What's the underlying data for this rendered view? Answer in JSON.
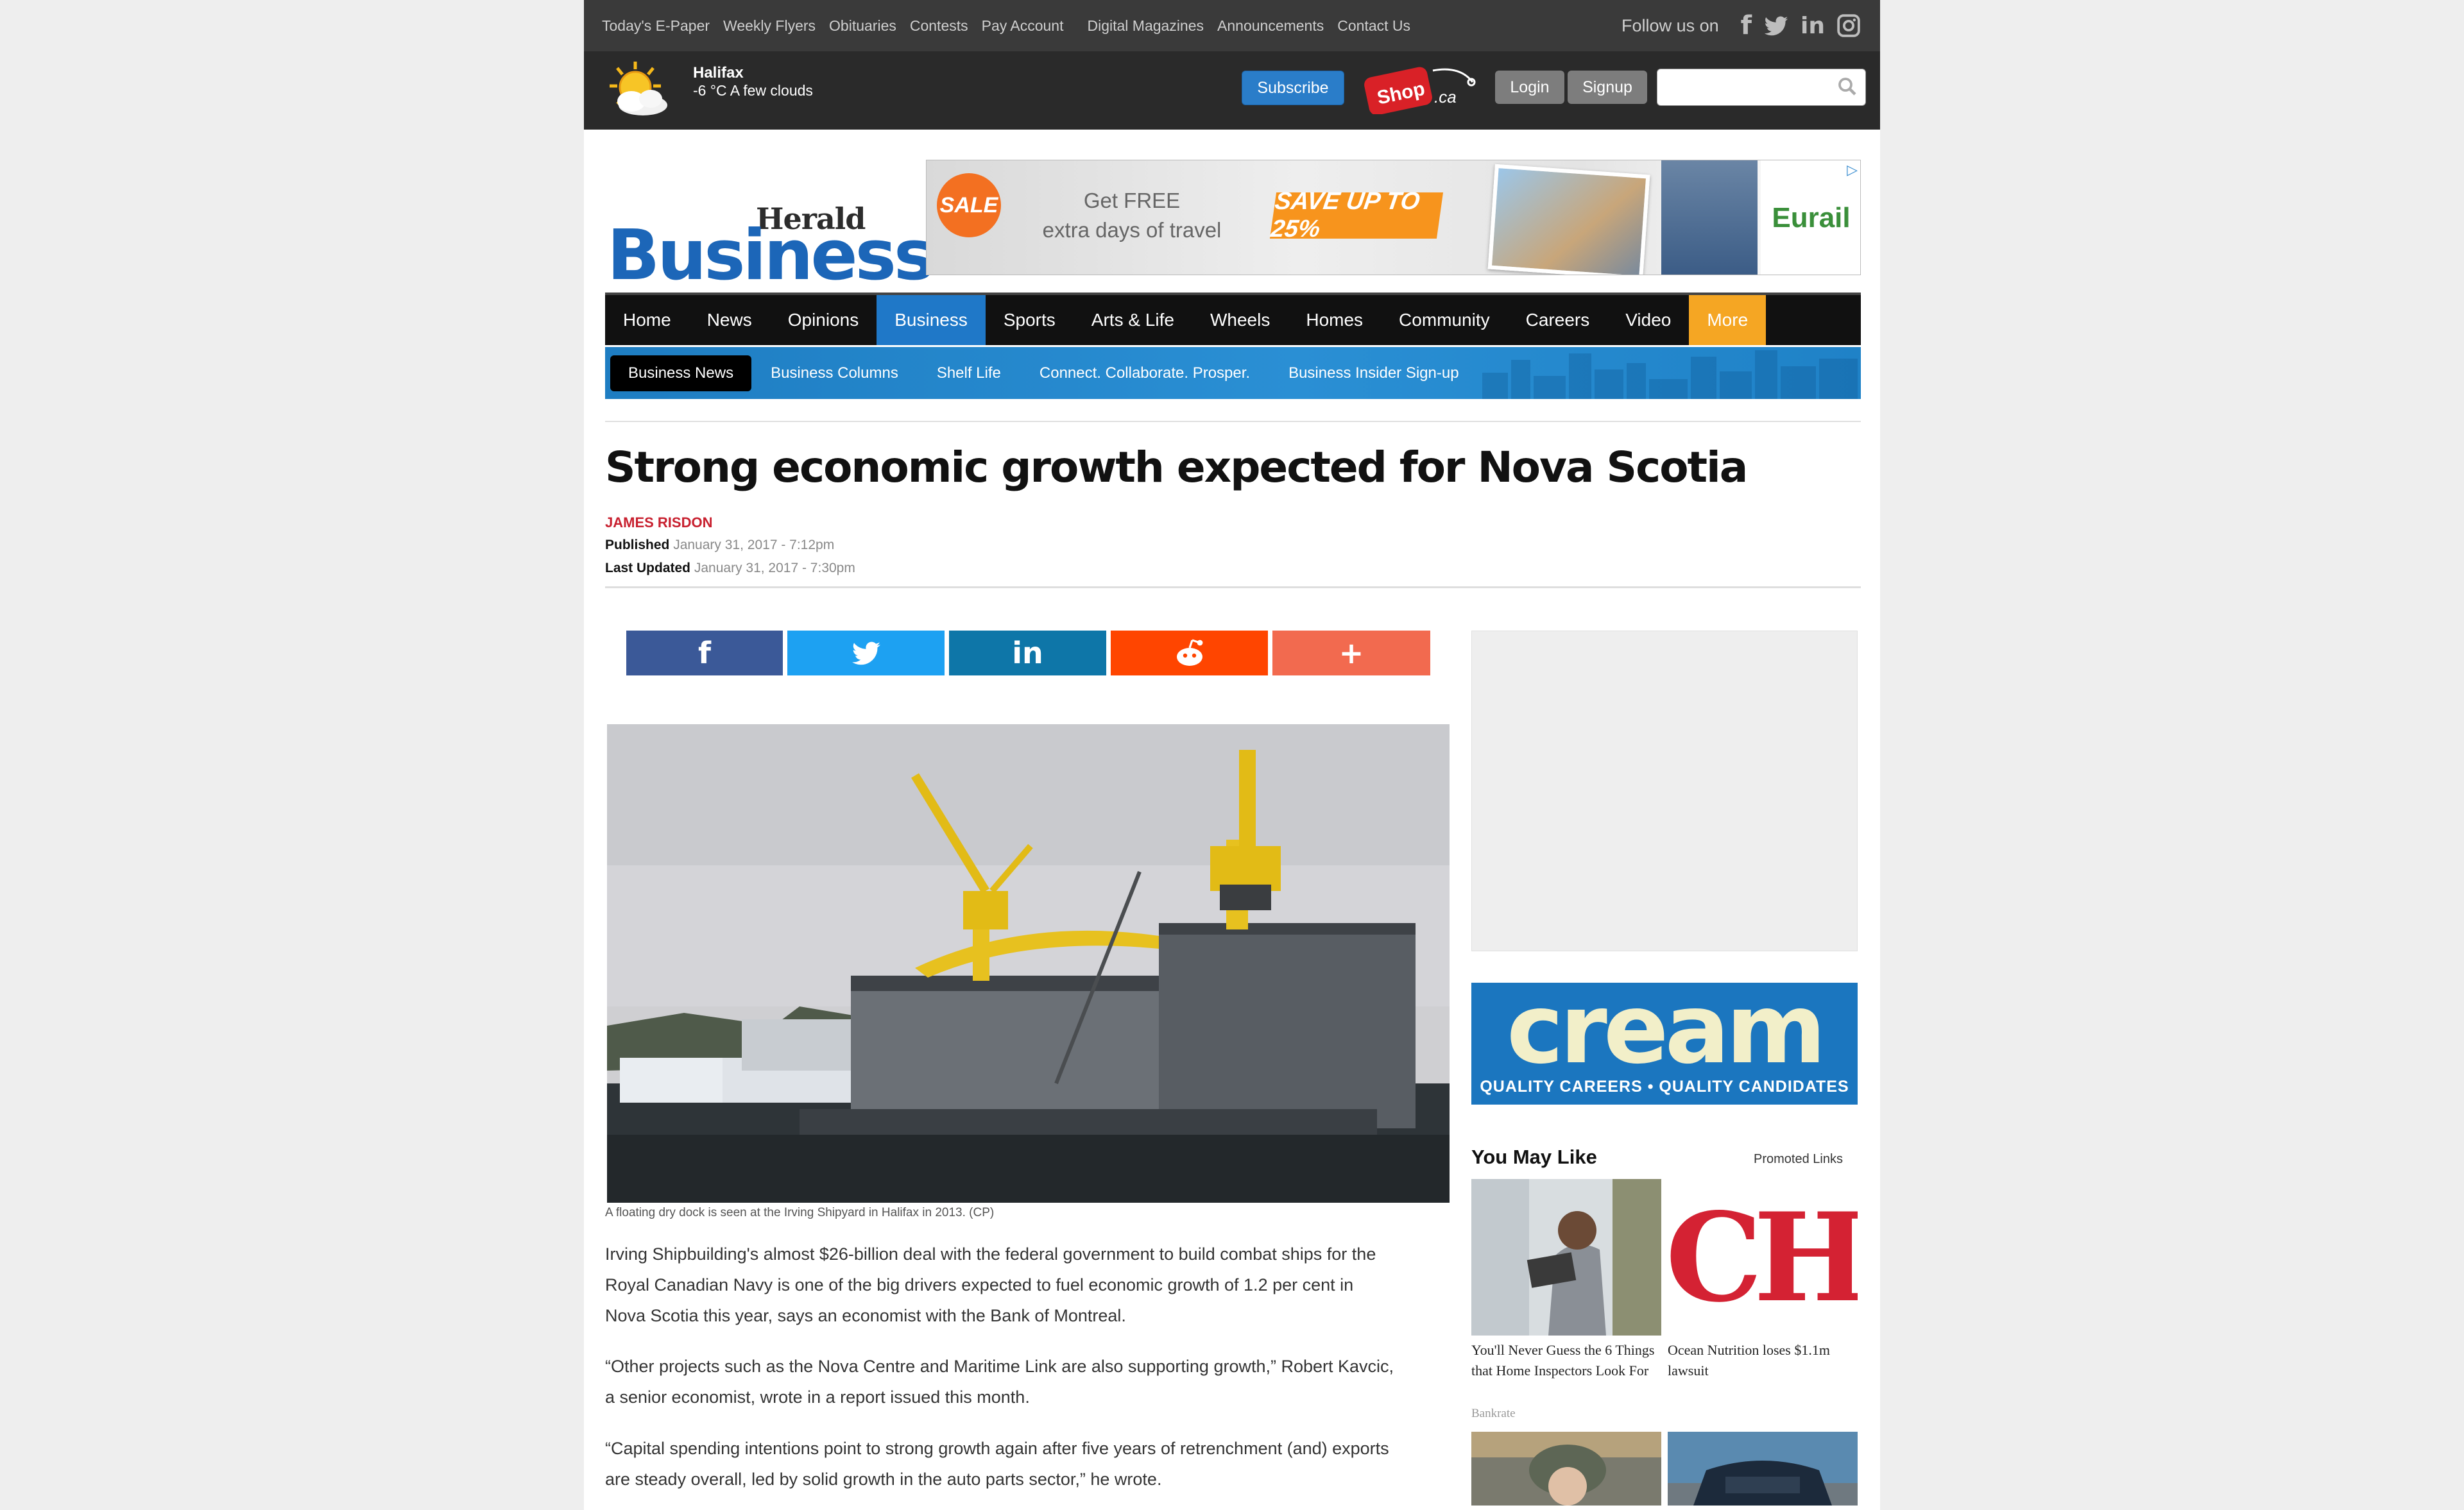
{
  "topnav": {
    "links": [
      "Today's E-Paper",
      "Weekly Flyers",
      "Obituaries",
      "Contests",
      "Pay Account",
      "Digital Magazines",
      "Announcements",
      "Contact Us"
    ],
    "follow_label": "Follow us on",
    "social_icons": [
      "facebook-icon",
      "twitter-icon",
      "linkedin-icon",
      "instagram-icon"
    ]
  },
  "weather": {
    "city": "Halifax",
    "condition": "-6 °C A few clouds"
  },
  "account": {
    "subscribe": "Subscribe",
    "shop_label": "Herald Shop.ca",
    "login": "Login",
    "signup": "Signup",
    "search_placeholder": ""
  },
  "logo": {
    "herald": "Herald",
    "business": "Business"
  },
  "ad_banner": {
    "sale": "SALE",
    "get_free_1": "Get FREE",
    "get_free_2": "extra days of travel",
    "save": "SAVE UP TO 25%",
    "brand": "Eurail"
  },
  "main_nav": {
    "items": [
      "Home",
      "News",
      "Opinions",
      "Business",
      "Sports",
      "Arts & Life",
      "Wheels",
      "Homes",
      "Community",
      "Careers",
      "Video",
      "More"
    ],
    "active": "Business"
  },
  "sub_nav": {
    "items": [
      "Business News",
      "Business Columns",
      "Shelf Life",
      "Connect. Collaborate. Prosper.",
      "Business Insider Sign-up"
    ],
    "active": "Business News"
  },
  "article": {
    "headline": "Strong economic growth expected for Nova Scotia",
    "author": "JAMES RISDON",
    "published_label": "Published",
    "published": "January 31, 2017 - 7:12pm",
    "updated_label": "Last Updated",
    "updated": "January 31, 2017 - 7:30pm",
    "image_caption": "A floating dry dock is seen at the Irving Shipyard in Halifax in 2013. (CP)",
    "paragraphs": [
      "Irving Shipbuilding's almost $26-billion deal with the federal government to build combat ships for the Royal Canadian Navy is one of the big drivers expected to fuel economic growth of 1.2 per cent in Nova Scotia this year, says an economist with the Bank of Montreal.",
      "“Other projects such as the Nova Centre and Maritime Link are also supporting growth,” Robert Kavcic, a senior economist, wrote in a report issued this month.",
      "“Capital spending intentions point to strong growth again after five years of retrenchment (and) exports are steady overall, led by solid growth in the auto parts sector,” he wrote."
    ]
  },
  "share_buttons": [
    {
      "network": "facebook",
      "icon": "f",
      "color": "#3b5998"
    },
    {
      "network": "twitter",
      "icon": "🐦",
      "color": "#1da1f2"
    },
    {
      "network": "linkedin",
      "icon": "in",
      "color": "#0e76a8"
    },
    {
      "network": "reddit",
      "icon": "👽",
      "color": "#ff4500"
    },
    {
      "network": "more",
      "icon": "+",
      "color": "#f26a4f"
    }
  ],
  "sidebar": {
    "cream_word": "cream",
    "cream_tagline": "QUALITY CAREERS • QUALITY CANDIDATES",
    "you_may_like": "You May Like",
    "promoted": "Promoted Links",
    "cards": [
      {
        "title": "You'll Never Guess the 6 Things that Home Inspectors Look For",
        "source": "Bankrate"
      },
      {
        "title": "Ocean Nutrition loses $1.1m lawsuit",
        "source": ""
      }
    ],
    "ch_logo": "CH"
  }
}
